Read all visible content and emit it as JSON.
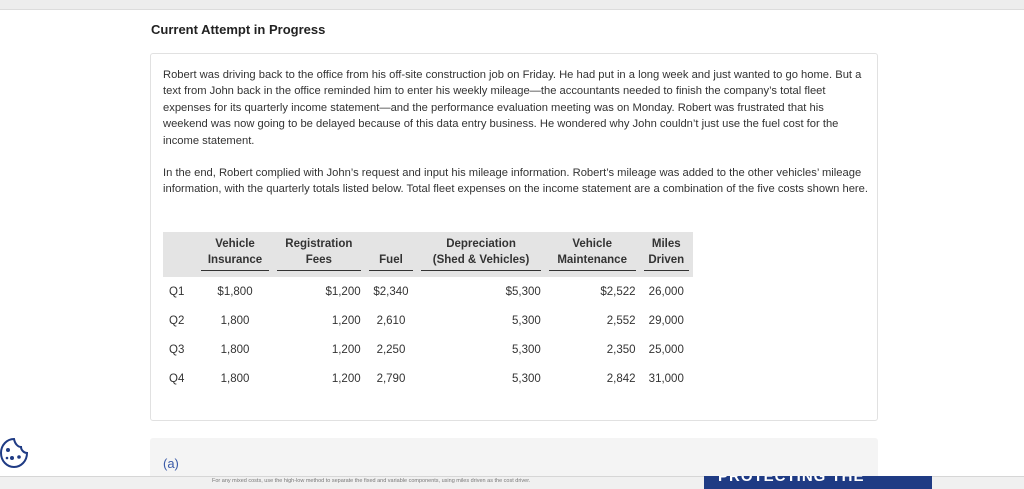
{
  "header": {
    "title": "Current Attempt in Progress"
  },
  "problem": {
    "paragraph1": "Robert was driving back to the office from his off-site construction job on Friday. He had put in a long week and just wanted to go home. But a text from John back in the office reminded him to enter his weekly mileage—the accountants needed to finish the company’s total fleet expenses for its quarterly income statement—and the performance evaluation meeting was on Monday. Robert was frustrated that his weekend was now going to be delayed because of this data entry business. He wondered why John couldn’t just use the fuel cost for the income statement.",
    "paragraph2": "In the end, Robert complied with John’s request and input his mileage information. Robert’s mileage was added to the other vehicles’ mileage information, with the quarterly totals listed below. Total fleet expenses on the income statement are a combination of the five costs shown here."
  },
  "table": {
    "headers": {
      "insurance_1": "Vehicle",
      "insurance_2": "Insurance",
      "registration_1": "Registration",
      "registration_2": "Fees",
      "fuel": "Fuel",
      "depreciation_1": "Depreciation",
      "depreciation_2": "(Shed & Vehicles)",
      "maintenance_1": "Vehicle",
      "maintenance_2": "Maintenance",
      "miles_1": "Miles",
      "miles_2": "Driven"
    },
    "rows": [
      {
        "label": "Q1",
        "insurance": "$1,800",
        "registration": "$1,200",
        "fuel": "$2,340",
        "depreciation": "$5,300",
        "maintenance": "$2,522",
        "miles": "26,000"
      },
      {
        "label": "Q2",
        "insurance": "1,800",
        "registration": "1,200",
        "fuel": "2,610",
        "depreciation": "5,300",
        "maintenance": "2,552",
        "miles": "29,000"
      },
      {
        "label": "Q3",
        "insurance": "1,800",
        "registration": "1,200",
        "fuel": "2,250",
        "depreciation": "5,300",
        "maintenance": "2,350",
        "miles": "25,000"
      },
      {
        "label": "Q4",
        "insurance": "1,800",
        "registration": "1,200",
        "fuel": "2,790",
        "depreciation": "5,300",
        "maintenance": "2,842",
        "miles": "31,000"
      }
    ]
  },
  "part": {
    "label": "(a)"
  },
  "footer": {
    "note": "For any mixed costs, use the high-low method to separate the fixed and variable components, using miles driven as the cost driver.",
    "banner": "PROTECTING THE"
  },
  "icons": {
    "cookie": "cookie-icon"
  },
  "colors": {
    "part_label": "#3a5aa8",
    "banner": "#1f3b84",
    "table_header_bg": "#e4e4e4"
  }
}
